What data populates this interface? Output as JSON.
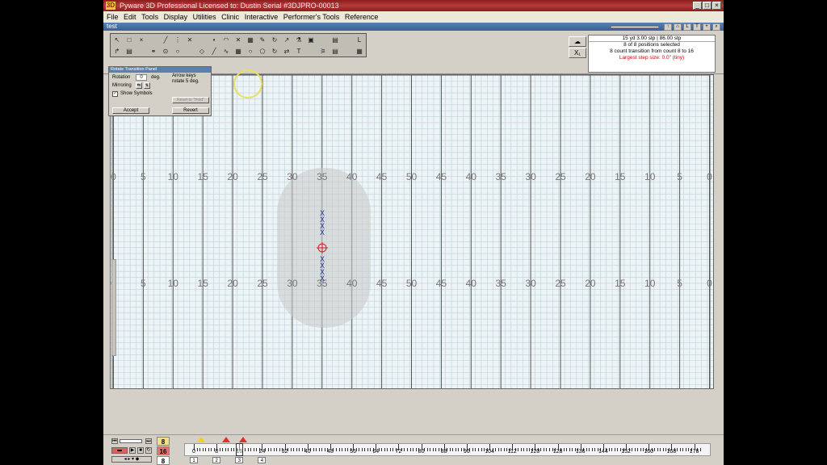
{
  "window": {
    "title": "Pyware 3D Professional     Licensed to: Dustin     Serial #3DJPRO-00013",
    "logo": "3D",
    "doc_tab": "test",
    "buttons": [
      "_",
      "□",
      "×"
    ]
  },
  "menu": [
    "File",
    "Edit",
    "Tools",
    "Display",
    "Utilities",
    "Clinic",
    "Interactive",
    "Performer's Tools",
    "Reference"
  ],
  "status": {
    "line1": "15 yd 3.00 stp | 86.00 stp",
    "line2": "8 of 8 positions selected",
    "line3": "8 count transition from count 8 to 16",
    "line4": "Largest step size: 0.0\" (tiny)",
    "warn_color": "#d40000"
  },
  "rotate_panel": {
    "title": "Rotate Transition Panel",
    "rotation_label": "Rotation",
    "rotation_value": "0",
    "deg": "deg.",
    "hint1": "Arrow keys",
    "hint2": "rotate 5 deg.",
    "mirroring_label": "Mirroring",
    "show_symbols": "Show Symbols",
    "reset_label": "Reset to \"Hold\"",
    "accept_label": "Accept",
    "revert_label": "Revert"
  },
  "field": {
    "yard_labels": [
      "0",
      "5",
      "10",
      "15",
      "20",
      "25",
      "30",
      "35",
      "40",
      "45",
      "50",
      "45",
      "40",
      "35",
      "30",
      "25",
      "20",
      "15",
      "10",
      "5",
      "0"
    ]
  },
  "timeline": {
    "counts": [
      "0",
      "8",
      "16",
      "24",
      "32",
      "40",
      "48",
      "56",
      "64",
      "72",
      "80",
      "88",
      "96",
      "104",
      "112",
      "120",
      "128",
      "136",
      "144",
      "152",
      "160",
      "168",
      "176"
    ],
    "pages": [
      "1",
      "2",
      "3",
      "4"
    ],
    "count_box": [
      "8",
      "16",
      "8"
    ]
  }
}
